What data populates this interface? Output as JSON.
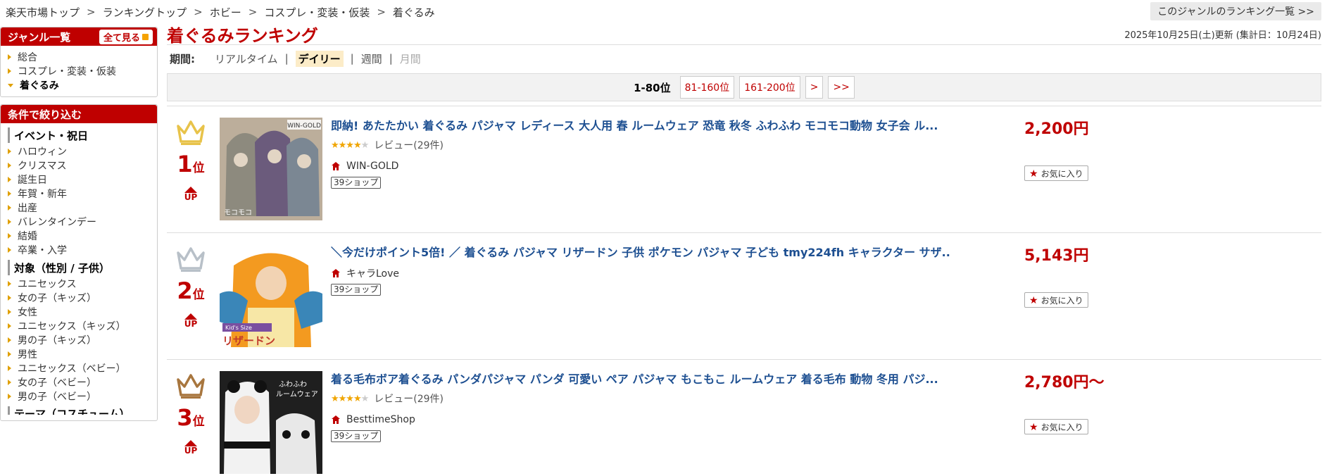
{
  "breadcrumb": {
    "items": [
      "楽天市場トップ",
      "ランキングトップ",
      "ホビー",
      "コスプレ・変装・仮装",
      "着ぐるみ"
    ],
    "sep": ">"
  },
  "genre_ranking_link": "このジャンルのランキング一覧 >>",
  "sidebar": {
    "genre_header": "ジャンル一覧",
    "see_all": "全て見る",
    "genres": [
      "総合",
      "コスプレ・変装・仮装",
      "着ぐるみ"
    ],
    "filter_header": "条件で絞り込む",
    "event_title": "イベント・祝日",
    "events": [
      "ハロウィン",
      "クリスマス",
      "誕生日",
      "年賀・新年",
      "出産",
      "バレンタインデー",
      "結婚",
      "卒業・入学"
    ],
    "target_title": "対象（性別 / 子供）",
    "targets": [
      "ユニセックス",
      "女の子（キッズ）",
      "女性",
      "ユニセックス（キッズ）",
      "男の子（キッズ）",
      "男性",
      "ユニセックス（ベビー）",
      "女の子（ベビー）",
      "男の子（ベビー）"
    ],
    "next_title": "テーマ（コスチューム）"
  },
  "main": {
    "title": "着ぐるみランキング",
    "updated": "2025年10月25日(土)更新 (集計日：10月24日)",
    "period_label": "期間:",
    "periods": [
      "リアルタイム",
      "デイリー",
      "週間",
      "月間"
    ],
    "pager": {
      "current": "1-80位",
      "pages": [
        "81-160位",
        "161-200位",
        ">",
        ">>"
      ]
    }
  },
  "items": [
    {
      "rank": "1",
      "rank_suffix": "位",
      "trend": "UP",
      "title": "即納! あたたかい 着ぐるみ パジャマ レディース 大人用 春 ルームウェア 恐竜 秋冬 ふわふわ モコモコ動物 女子会 ル...",
      "review": "レビュー(29件)",
      "shop": "WIN-GOLD",
      "shop_badge": "39ショップ",
      "price": "2,200円",
      "favorite": "お気に入り",
      "thumb_label": "WIN-GOLD",
      "thumb_caption": "モコモコ"
    },
    {
      "rank": "2",
      "rank_suffix": "位",
      "trend": "UP",
      "title": "＼今だけポイント5倍! ／ 着ぐるみ パジャマ リザードン 子供 ポケモン パジャマ 子ども tmy224fh キャラクター サザ...",
      "review": "",
      "shop": "キャラLove",
      "shop_badge": "39ショップ",
      "price": "5,143円",
      "favorite": "お気に入り",
      "thumb_label": "Kid's Size",
      "thumb_caption": "リザードン"
    },
    {
      "rank": "3",
      "rank_suffix": "位",
      "trend": "UP",
      "title": "着る毛布ボア着ぐるみ パンダパジャマ パンダ 可愛い ペア パジャマ もこもこ ルームウェア 着る毛布 動物 冬用 パジ...",
      "review": "レビュー(29件)",
      "shop": "BesttimeShop",
      "shop_badge": "39ショップ",
      "price": "2,780円～",
      "favorite": "お気に入り",
      "thumb_label": "ふわふわ",
      "thumb_caption": "ルームウェア"
    }
  ],
  "colors": {
    "accent": "#bf0000",
    "link": "#1d4f91",
    "gold": "#e8c34a",
    "silver": "#b8c0c8",
    "bronze": "#a8763e"
  }
}
